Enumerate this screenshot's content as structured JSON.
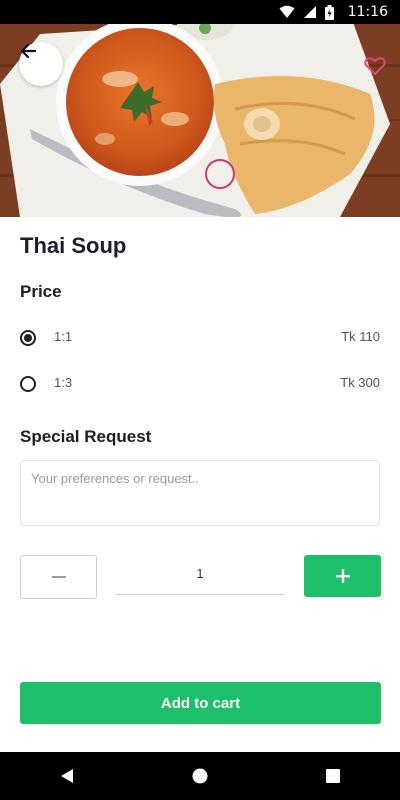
{
  "status_bar": {
    "time": "11:16"
  },
  "product": {
    "name": "Thai Soup"
  },
  "price_section": {
    "label": "Price",
    "options": [
      {
        "label": "1:1",
        "price": "Tk 110",
        "selected": true
      },
      {
        "label": "1:3",
        "price": "Tk 300",
        "selected": false
      }
    ]
  },
  "special_request": {
    "label": "Special Request",
    "placeholder": "Your preferences or request.."
  },
  "quantity": {
    "value": "1"
  },
  "actions": {
    "add_to_cart": "Add to cart"
  },
  "icons": {
    "back": "arrow-left-icon",
    "favorite": "heart-outline-icon",
    "minus": "minus-icon",
    "plus": "plus-icon"
  },
  "colors": {
    "accent": "#1dbf6a",
    "favorite": "#e0457b"
  }
}
